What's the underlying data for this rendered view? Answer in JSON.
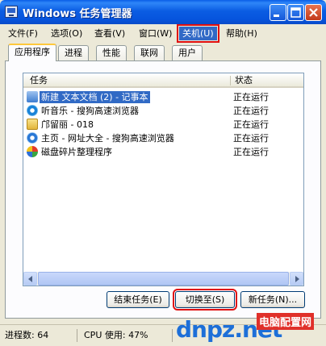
{
  "window": {
    "title": "Windows 任务管理器"
  },
  "menu": [
    {
      "label": "文件(F)"
    },
    {
      "label": "选项(O)"
    },
    {
      "label": "查看(V)"
    },
    {
      "label": "窗口(W)"
    },
    {
      "label": "关机(U)"
    },
    {
      "label": "帮助(H)"
    }
  ],
  "tabs": [
    {
      "label": "应用程序"
    },
    {
      "label": "进程"
    },
    {
      "label": "性能"
    },
    {
      "label": "联网"
    },
    {
      "label": "用户"
    }
  ],
  "list": {
    "columns": {
      "task": "任务",
      "status": "状态"
    },
    "rows": [
      {
        "name": "新建 文本文档 (2) - 记事本",
        "status": "正在运行",
        "icon": "notepad-icon",
        "selected": true
      },
      {
        "name": "听音乐 - 搜狗高速浏览器",
        "status": "正在运行",
        "icon": "music-icon"
      },
      {
        "name": "邝留丽 - 018",
        "status": "正在运行",
        "icon": "folder-icon"
      },
      {
        "name": "主页 - 网址大全 - 搜狗高速浏览器",
        "status": "正在运行",
        "icon": "browser-icon"
      },
      {
        "name": "磁盘碎片整理程序",
        "status": "正在运行",
        "icon": "defrag-icon"
      }
    ]
  },
  "buttons": {
    "end_task": "结束任务(E)",
    "switch_to": "切换至(S)",
    "new_task": "新任务(N)..."
  },
  "status": {
    "processes": "进程数: 64",
    "cpu": "CPU 使用: 47%"
  },
  "watermark": {
    "brand": "dnpz.net",
    "tagline": "电脑配置网"
  },
  "colors": {
    "title_bar": "#0A5FE6",
    "selection": "#316AC5",
    "highlight_box": "#E01010",
    "watermark_blue": "#1D6FD8",
    "watermark_red": "#E0302A"
  }
}
